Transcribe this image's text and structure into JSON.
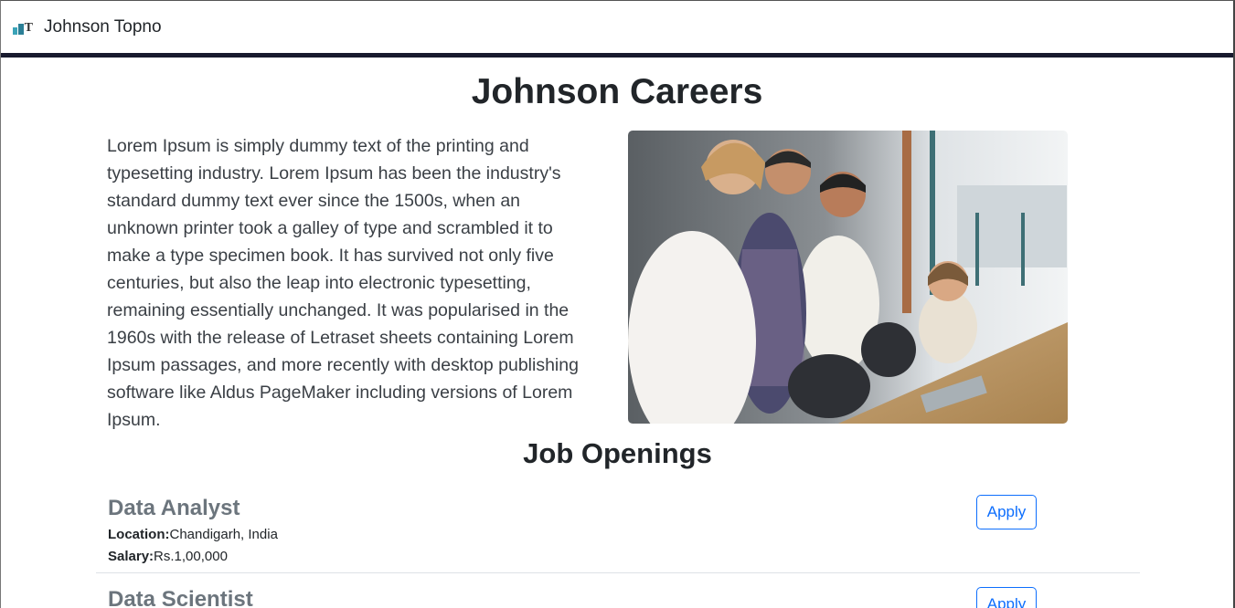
{
  "navbar": {
    "brand": "Johnson Topno",
    "logo_icon": "company-logo-icon"
  },
  "hero": {
    "title": "Johnson Careers",
    "paragraph": "Lorem Ipsum is simply dummy text of the printing and typesetting industry. Lorem Ipsum has been the industry's standard dummy text ever since the 1500s, when an unknown printer took a galley of type and scrambled it to make a type specimen book. It has survived not only five centuries, but also the leap into electronic typesetting, remaining essentially unchanged. It was popularised in the 1960s with the release of Letraset sheets containing Lorem Ipsum passages, and more recently with desktop publishing software like Aldus PageMaker including versions of Lorem Ipsum.",
    "image": "team-office-photo"
  },
  "jobs": {
    "title": "Job Openings",
    "location_label": "Location:",
    "salary_label": "Salary:",
    "items": [
      {
        "title": "Data Analyst",
        "location": "Chandigarh, India",
        "salary": "Rs.1,00,000",
        "apply_label": "Apply"
      },
      {
        "title": "Data Scientist",
        "apply_label": "Apply"
      }
    ]
  },
  "colors": {
    "nav_rule": "#181a2e",
    "accent": "#0d6efd",
    "job_title": "#6c757d"
  }
}
